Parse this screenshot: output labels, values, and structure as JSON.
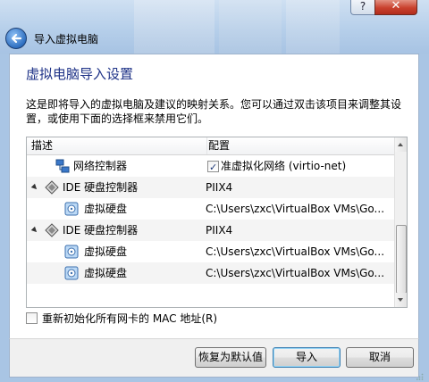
{
  "window": {
    "title": "导入虚拟电脑",
    "help_label": "?",
    "close_label": "✕"
  },
  "content": {
    "heading": "虚拟电脑导入设置",
    "description": "这是即将导入的虚拟电脑及建议的映射关系。您可以通过双击该项目来调整其设置，或使用下面的选择框来禁用它们。"
  },
  "tree": {
    "col_desc": "描述",
    "col_config": "配置",
    "rows": [
      {
        "label": "网络控制器",
        "value": "准虚拟化网络 (virtio-net)",
        "checked": true,
        "icon": "network-adapter-icon"
      },
      {
        "label": "IDE 硬盘控制器",
        "value": "PIIX4",
        "icon": "ide-controller-icon"
      },
      {
        "label": "虚拟硬盘",
        "value": "C:\\Users\\zxc\\VirtualBox VMs\\Go...",
        "icon": "hard-disk-icon"
      },
      {
        "label": "IDE 硬盘控制器",
        "value": "PIIX4",
        "icon": "ide-controller-icon"
      },
      {
        "label": "虚拟硬盘",
        "value": "C:\\Users\\zxc\\VirtualBox VMs\\Go...",
        "icon": "hard-disk-icon"
      },
      {
        "label": "虚拟硬盘",
        "value": "C:\\Users\\zxc\\VirtualBox VMs\\Go...",
        "icon": "hard-disk-icon"
      }
    ]
  },
  "options": {
    "reinit_mac_label": "重新初始化所有网卡的 MAC 地址(R)",
    "reinit_mac_checked": false
  },
  "buttons": {
    "restore_defaults": "恢复为默认值",
    "import": "导入",
    "cancel": "取消"
  },
  "colors": {
    "heading": "#1e3287",
    "frame": "#a9c5e4",
    "close_button": "#c9412e"
  }
}
